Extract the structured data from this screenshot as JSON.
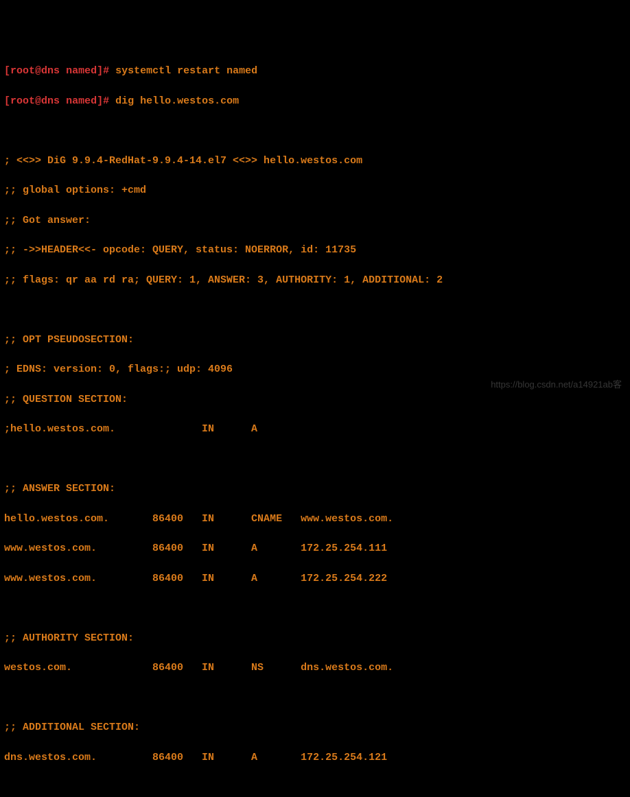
{
  "prompt": {
    "open": "[",
    "user": "root",
    "at": "@",
    "host": "dns",
    "space": " ",
    "dir": "named",
    "close": "]",
    "hash": "# "
  },
  "commands": {
    "cmd1": "systemctl restart named",
    "cmd2": "dig hello.westos.com"
  },
  "dig": {
    "version_line": "; <<>> DiG 9.9.4-RedHat-9.9.4-14.el7 <<>> hello.westos.com",
    "global_options": ";; global options: +cmd",
    "got_answer": ";; Got answer:",
    "header": ";; ->>HEADER<<- opcode: QUERY, status: NOERROR, id: 11735",
    "flags": ";; flags: qr aa rd ra; QUERY: 1, ANSWER: 3, AUTHORITY: 1, ADDITIONAL: 2",
    "opt_pseudo": ";; OPT PSEUDOSECTION:",
    "edns": "; EDNS: version: 0, flags:; udp: 4096",
    "question_header": ";; QUESTION SECTION:",
    "question_row": ";hello.westos.com.              IN      A",
    "answer_header": ";; ANSWER SECTION:",
    "answer1": "hello.westos.com.       86400   IN      CNAME   www.westos.com.",
    "answer2": "www.westos.com.         86400   IN      A       172.25.254.111",
    "answer3": "www.westos.com.         86400   IN      A       172.25.254.222",
    "authority_header": ";; AUTHORITY SECTION:",
    "authority1": "westos.com.             86400   IN      NS      dns.westos.com.",
    "additional_header": ";; ADDITIONAL SECTION:",
    "additional1": "dns.westos.com.         86400   IN      A       172.25.254.121"
  },
  "watermark": "https://blog.csdn.net/a14921ab客"
}
